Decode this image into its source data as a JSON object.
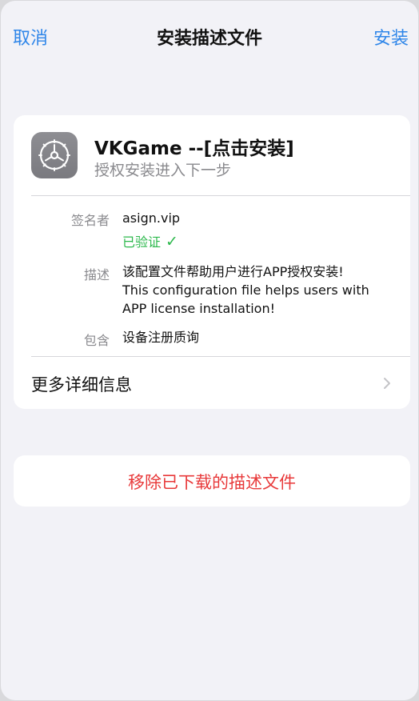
{
  "nav": {
    "cancel_label": "取消",
    "title": "安装描述文件",
    "install_label": "安装"
  },
  "profile": {
    "app_name": "VKGame --[点击安装]",
    "subtitle": "授权安装进入下一步",
    "icon": "gear-icon",
    "signer_label": "签名者",
    "signer_value": "asign.vip",
    "verified_label": "已验证",
    "verified_icon": "checkmark-icon",
    "description_label": "描述",
    "description_lines": [
      "该配置文件帮助用户进行APP授权安装!",
      "This configuration file helps users with",
      "APP license installation!"
    ],
    "contains_label": "包含",
    "contains_value": "设备注册质询",
    "more_details_label": "更多详细信息"
  },
  "remove": {
    "label": "移除已下载的描述文件"
  },
  "colors": {
    "accent_blue": "#2f86e9",
    "verified_green": "#2cb84c",
    "destructive_red": "#e8393a",
    "background": "#f2f2f7"
  }
}
